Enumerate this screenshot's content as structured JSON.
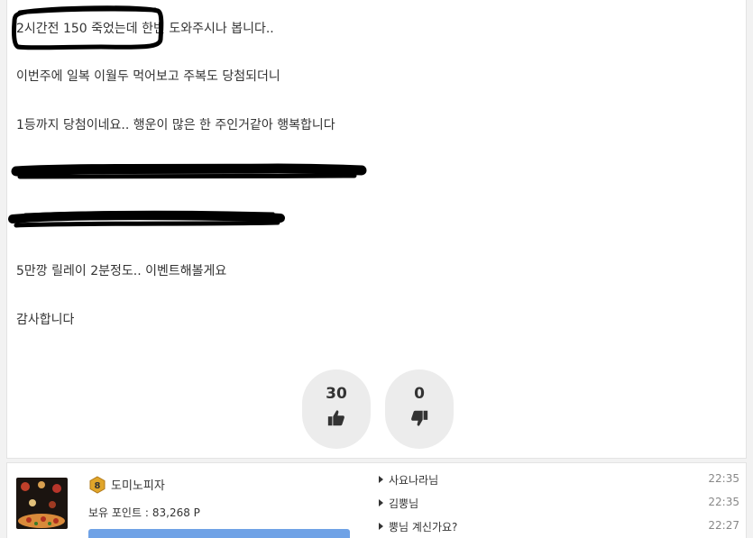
{
  "post": {
    "lines": [
      "2시간전 150 죽었는데 한번 도와주시나 봅니다..",
      "이번주에 일복 이월두 먹어보고 주복도 당첨되더니",
      "1등까지 당첨이네요.. 행운이 많은 한 주인거같아 행복합니다",
      "5만깡 릴레이 2분정도.. 이벤트해볼게요",
      "감사합니다"
    ]
  },
  "votes": {
    "up_count": "30",
    "down_count": "0",
    "up_icon": "thumbs-up-icon",
    "down_icon": "thumbs-down-icon"
  },
  "author": {
    "level": "8",
    "nickname": "도미노피자",
    "points_label": "보유 포인트 :",
    "points_value": "83,268 P"
  },
  "side_list": [
    {
      "title": "사요나라님",
      "time": "22:35"
    },
    {
      "title": "김뿡님",
      "time": "22:35"
    },
    {
      "title": "뿡님 계신가요?",
      "time": "22:27"
    }
  ],
  "colors": {
    "accent_blue": "#6fa2e6",
    "level_badge": "#e0a52a"
  }
}
